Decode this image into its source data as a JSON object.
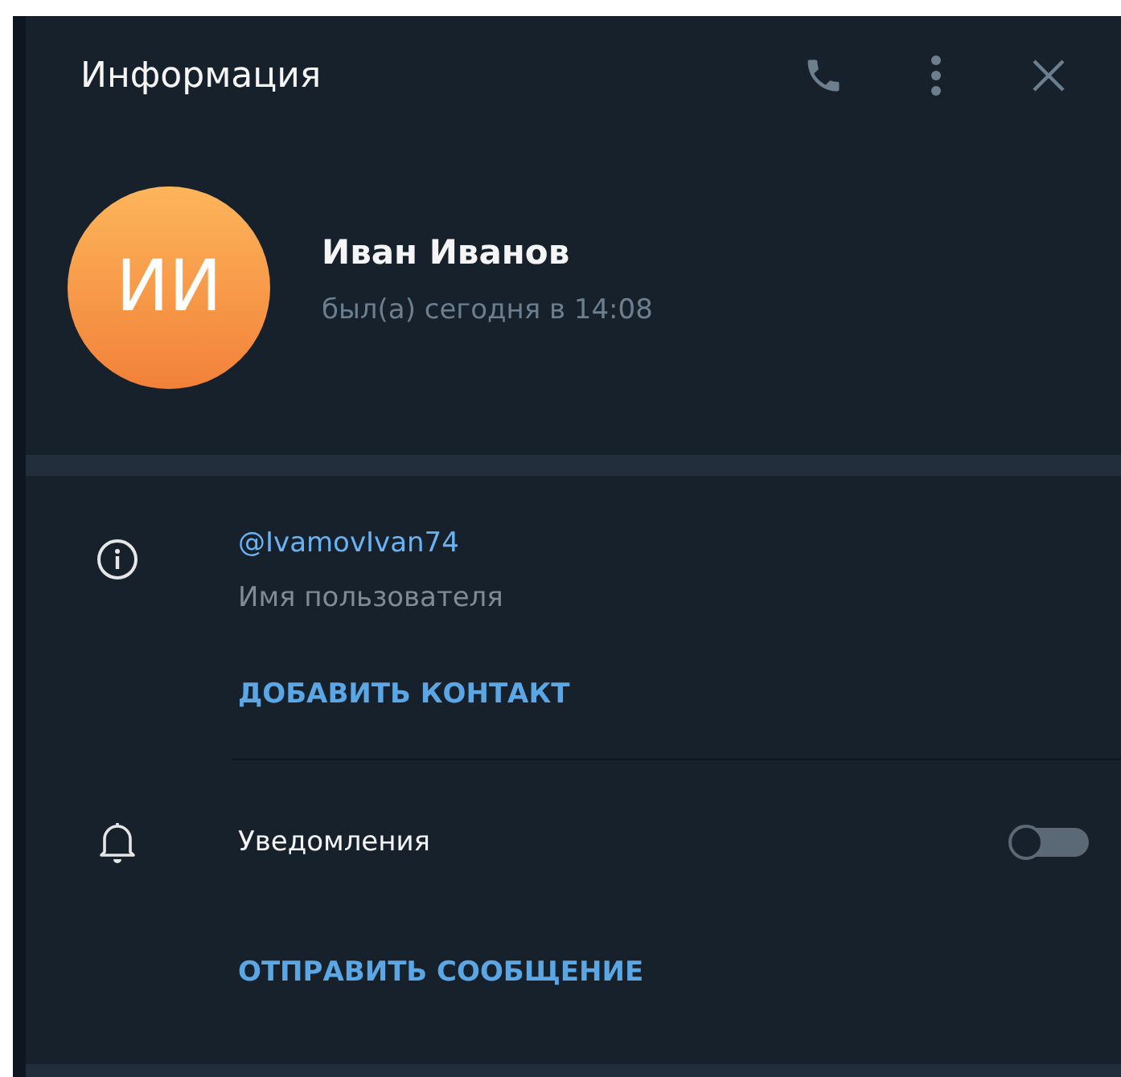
{
  "window": {
    "title": "Информация"
  },
  "profile": {
    "initials": "ИИ",
    "name": "Иван Иванов",
    "status": "был(а) сегодня в 14:08"
  },
  "username": {
    "value": "@IvamovIvan74",
    "label": "Имя пользователя"
  },
  "add_contact": "ДОБАВИТЬ КОНТАКТ",
  "notifications": {
    "label": "Уведомления",
    "on": false
  },
  "send_message": "ОТПРАВИТЬ СООБЩЕНИЕ"
}
